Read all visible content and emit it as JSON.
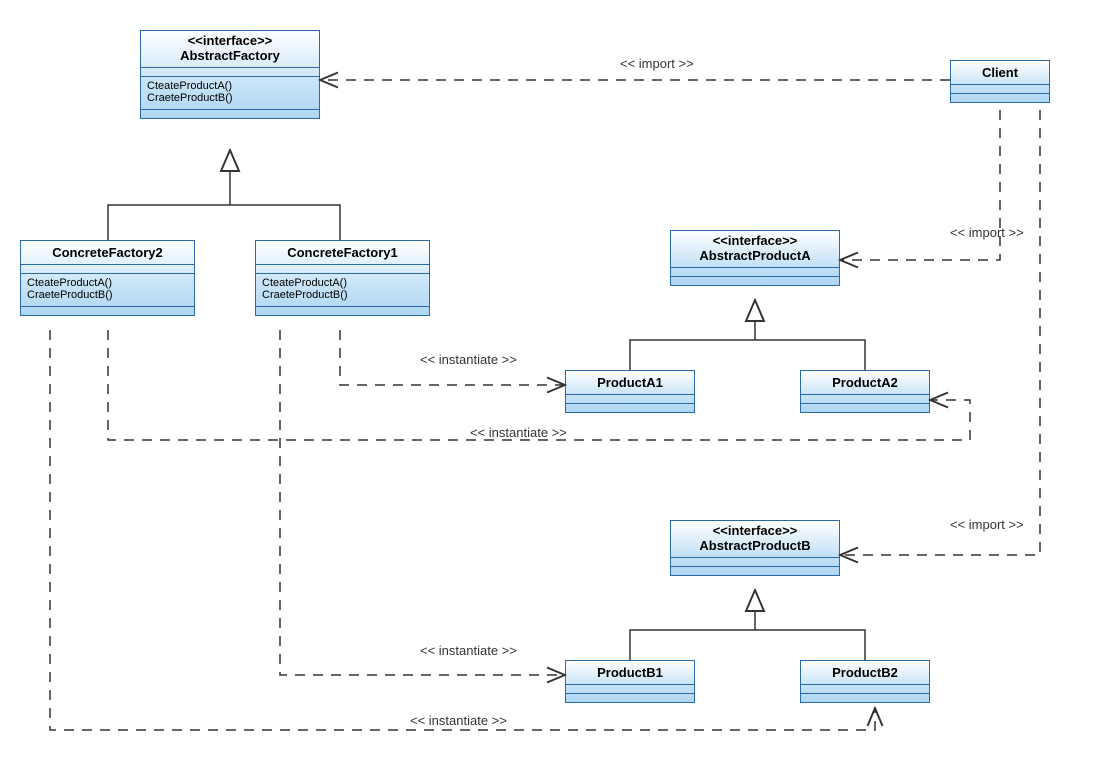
{
  "stereotype_interface": "<<interface>>",
  "labels": {
    "import": "<< import >>",
    "instantiate": "<< instantiate >>"
  },
  "abstractFactory": {
    "name": "AbstractFactory",
    "op1": "CteateProductA()",
    "op2": "CraeteProductB()"
  },
  "client": {
    "name": "Client"
  },
  "concreteFactory1": {
    "name": "ConcreteFactory1",
    "op1": "CteateProductA()",
    "op2": "CraeteProductB()"
  },
  "concreteFactory2": {
    "name": "ConcreteFactory2",
    "op1": "CteateProductA()",
    "op2": "CraeteProductB()"
  },
  "abstractProductA": {
    "name": "AbstractProductA"
  },
  "abstractProductB": {
    "name": "AbstractProductB"
  },
  "productA1": {
    "name": "ProductA1"
  },
  "productA2": {
    "name": "ProductA2"
  },
  "productB1": {
    "name": "ProductB1"
  },
  "productB2": {
    "name": "ProductB2"
  }
}
